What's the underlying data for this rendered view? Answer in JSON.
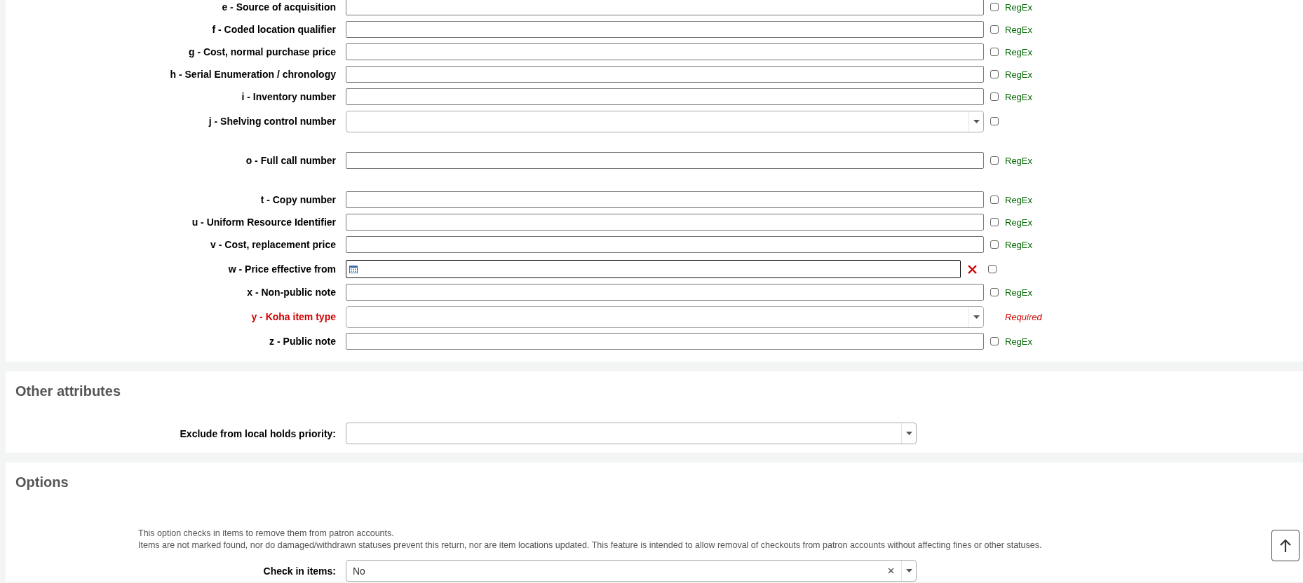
{
  "subfields": [
    {
      "label": "e - Source of acquisition",
      "kind": "text",
      "required": false,
      "checked": false,
      "regex_label": "RegEx"
    },
    {
      "label": "f - Coded location qualifier",
      "kind": "text",
      "required": false,
      "checked": false,
      "regex_label": "RegEx"
    },
    {
      "label": "g - Cost, normal purchase price",
      "kind": "text",
      "required": false,
      "checked": false,
      "regex_label": "RegEx"
    },
    {
      "label": "h - Serial Enumeration / chronology",
      "kind": "text",
      "required": false,
      "checked": false,
      "regex_label": "RegEx"
    },
    {
      "label": "i - Inventory number",
      "kind": "text",
      "required": false,
      "checked": false,
      "regex_label": "RegEx"
    },
    {
      "label": "j - Shelving control number",
      "kind": "select",
      "required": false,
      "checked": false
    },
    {
      "label": "o - Full call number",
      "kind": "text",
      "required": false,
      "checked": false,
      "regex_label": "RegEx"
    },
    {
      "label": "t - Copy number",
      "kind": "text",
      "required": false,
      "checked": false,
      "regex_label": "RegEx"
    },
    {
      "label": "u - Uniform Resource Identifier",
      "kind": "text",
      "required": false,
      "checked": false,
      "regex_label": "RegEx"
    },
    {
      "label": "v - Cost, replacement price",
      "kind": "text",
      "required": false,
      "checked": false,
      "regex_label": "RegEx"
    },
    {
      "label": "w - Price effective from",
      "kind": "date",
      "required": false,
      "checked": false
    },
    {
      "label": "x - Non-public note",
      "kind": "text",
      "required": false,
      "checked": false,
      "regex_label": "RegEx"
    },
    {
      "label": "y - Koha item type",
      "kind": "select",
      "required": true,
      "note": "Required"
    },
    {
      "label": "z - Public note",
      "kind": "text",
      "required": false,
      "checked": false,
      "regex_label": "RegEx"
    }
  ],
  "other_attributes": {
    "title": "Other attributes",
    "fields": [
      {
        "label": "Exclude from local holds priority:",
        "kind": "select",
        "clearable": false
      }
    ]
  },
  "options": {
    "title": "Options",
    "help": [
      "This option checks in items to remove them from patron accounts.",
      "Items are not marked found, nor do damaged/withdrawn statuses prevent this return, nor are item locations updated. This feature is intended to allow removal of checkouts from patron accounts without affecting fines or other statuses."
    ],
    "fields": [
      {
        "label": "Check in items:",
        "kind": "select",
        "value": "No",
        "clearable": true
      }
    ]
  }
}
